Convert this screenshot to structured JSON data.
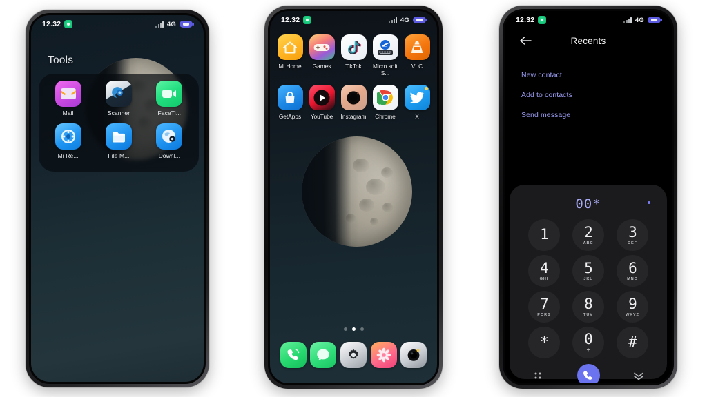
{
  "meta": {
    "background_color": "#ffffff",
    "accent_color": "#6b73ee",
    "link_color": "#9b9cf2"
  },
  "status_bar": {
    "time": "12.32",
    "network": "4G",
    "badge_icon": "recording-indicator-icon",
    "signal_icon": "signal-bars-icon",
    "battery_icon": "battery-icon"
  },
  "phone1": {
    "name": "folder-screen",
    "folder_title": "Tools",
    "apps": [
      {
        "label": "Mail",
        "icon": "mail-icon"
      },
      {
        "label": "Scanner",
        "icon": "scanner-icon"
      },
      {
        "label": "FaceTi...",
        "icon": "facetime-icon"
      },
      {
        "label": "Mi Re...",
        "icon": "mi-remote-icon"
      },
      {
        "label": "File M...",
        "icon": "file-manager-icon"
      },
      {
        "label": "Downl...",
        "icon": "downloads-icon"
      }
    ]
  },
  "phone2": {
    "name": "home-screen",
    "apps": [
      {
        "label": "Mi Home",
        "icon": "mi-home-icon"
      },
      {
        "label": "Games",
        "icon": "games-icon"
      },
      {
        "label": "TikTok",
        "icon": "tiktok-icon"
      },
      {
        "label": "Micro soft S...",
        "icon": "microsoft-swiftkey-icon"
      },
      {
        "label": "VLC",
        "icon": "vlc-icon"
      },
      {
        "label": "GetApps",
        "icon": "getapps-icon"
      },
      {
        "label": "YouTube",
        "icon": "youtube-icon"
      },
      {
        "label": "Instagram",
        "icon": "instagram-icon"
      },
      {
        "label": "Chrome",
        "icon": "chrome-icon"
      },
      {
        "label": "X",
        "icon": "x-twitter-icon"
      }
    ],
    "page_indicator": {
      "total": 3,
      "active": 2
    },
    "dock": [
      {
        "name": "phone-app",
        "icon": "phone-icon"
      },
      {
        "name": "messages-app",
        "icon": "message-bubble-icon"
      },
      {
        "name": "settings-app",
        "icon": "gear-icon"
      },
      {
        "name": "photos-app",
        "icon": "flower-icon"
      },
      {
        "name": "camera-app",
        "icon": "camera-icon"
      }
    ]
  },
  "phone3": {
    "name": "dialer-screen",
    "title": "Recents",
    "back_icon": "arrow-left-icon",
    "links": [
      "New contact",
      "Add to contacts",
      "Send message"
    ],
    "dialed_number": "00*",
    "keys": [
      {
        "digit": "1",
        "sub": ""
      },
      {
        "digit": "2",
        "sub": "ABC"
      },
      {
        "digit": "3",
        "sub": "DEF"
      },
      {
        "digit": "4",
        "sub": "GHI"
      },
      {
        "digit": "5",
        "sub": "JKL"
      },
      {
        "digit": "6",
        "sub": "MNO"
      },
      {
        "digit": "7",
        "sub": "PQRS"
      },
      {
        "digit": "8",
        "sub": "TUV"
      },
      {
        "digit": "9",
        "sub": "WXYZ"
      },
      {
        "digit": "*",
        "sub": ""
      },
      {
        "digit": "0",
        "sub": "+"
      },
      {
        "digit": "#",
        "sub": ""
      }
    ],
    "actions": {
      "left_icon": "keypad-grid-icon",
      "call_icon": "phone-call-icon",
      "right_icon": "chevron-double-down-icon"
    }
  }
}
